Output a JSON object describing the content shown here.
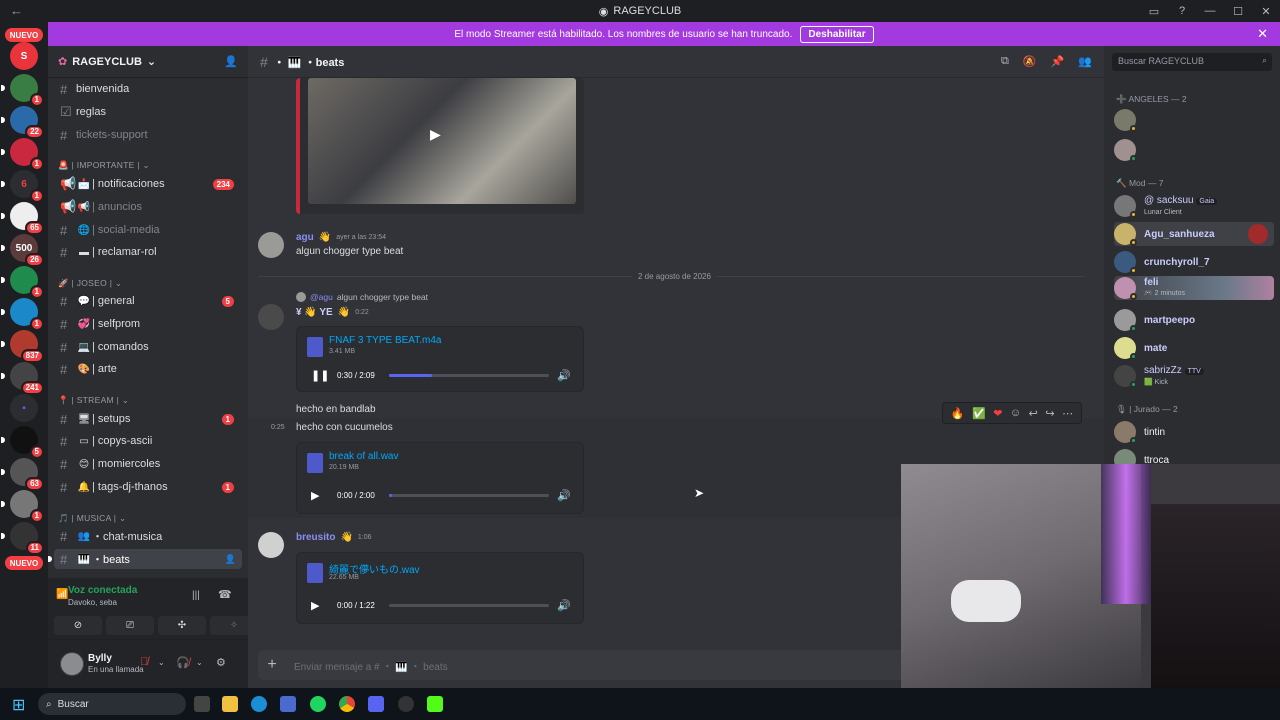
{
  "window": {
    "title": "RAGEYCLUB"
  },
  "banner": {
    "text": "El modo Streamer está habilitado. Los nombres de usuario se han truncado.",
    "button": "Deshabilitar"
  },
  "guilds": {
    "nuevo_top": "NUEVO",
    "nuevo_bottom": "NUEVO",
    "badges": [
      "1",
      "22",
      "1",
      "1",
      "65",
      "26",
      "1",
      "1",
      "837",
      "241",
      "5",
      "63",
      "1",
      "11"
    ]
  },
  "server": {
    "name": "RAGEYCLUB"
  },
  "categories": {
    "importante": "| IMPORTANTE |",
    "joseo": "| JOSEO |",
    "stream": "| STREAM |",
    "musica": "| MUSICA |"
  },
  "channels": [
    {
      "label": "bienvenida"
    },
    {
      "label": "reglas"
    },
    {
      "label": "tickets-support"
    },
    {
      "label": "| notificaciones",
      "badge": "234"
    },
    {
      "label": "| anuncios"
    },
    {
      "label": "| social-media"
    },
    {
      "label": "| reclamar-rol"
    },
    {
      "label": "| general",
      "badge": "5"
    },
    {
      "label": "| selfprom"
    },
    {
      "label": "| comandos"
    },
    {
      "label": "| arte"
    },
    {
      "label": "| setups",
      "badge": "1"
    },
    {
      "label": "| copys-ascii"
    },
    {
      "label": "| momiercoles"
    },
    {
      "label": "| tags-dj-thanos",
      "badge": "1"
    },
    {
      "label": "・chat-musica"
    },
    {
      "label": "・beats"
    }
  ],
  "voice": {
    "status": "Voz conectada",
    "sub": "Davoko, seba"
  },
  "user": {
    "name": "Bylly",
    "status": "En una llamada"
  },
  "header": {
    "channel": "・ 🎹 ・beats"
  },
  "messages": {
    "m1": {
      "author": "agu",
      "time": "ayer a las 23:54",
      "text": "algun chogger type beat"
    },
    "date_divider": "2 de agosto de 2026",
    "m2": {
      "reply_author": "@agu",
      "reply_text": "algun chogger type beat",
      "author": "¥ 👋 YE",
      "time": "0:22"
    },
    "a1": {
      "file": "FNAF 3 TYPE BEAT.m4a",
      "size": "3.41 MB",
      "time": "0:30 / 2:09",
      "progress": 0.27
    },
    "m2b": {
      "text": "hecho en bandlab"
    },
    "m2c": {
      "time": "0:25",
      "text": "hecho con cucumelos"
    },
    "a2": {
      "file": "break of all.wav",
      "size": "20.19 MB",
      "time": "0:00 / 2:00",
      "progress": 0.02
    },
    "m3": {
      "author": "breusito",
      "time": "1:06"
    },
    "a3": {
      "file": "綺麗で儚いもの.wav",
      "size": "22.65 MB",
      "time": "0:00 / 1:22",
      "progress": 0.0
    }
  },
  "composer": {
    "placeholder": "Enviar mensaje a # ・ 🎹 ・ beats"
  },
  "search": {
    "placeholder": "Buscar RAGEYCLUB"
  },
  "members": {
    "angeles": "ANGELES — 2",
    "mod": "Mod — 7",
    "jurado": "| Jurado — 2",
    "list": [
      {
        "name": "@ sacksuu",
        "tag": "Gaia",
        "sub": "Lunar Client",
        "color": "#c9cdfb"
      },
      {
        "name": "Agu_sanhueza",
        "color": "#c9cdfb"
      },
      {
        "name": "crunchyroll_7",
        "color": "#c9cdfb"
      },
      {
        "name": "feli",
        "sub": "2 minutos",
        "color": "#c9cdfb"
      },
      {
        "name": "martpeepo",
        "color": "#c9cdfb"
      },
      {
        "name": "mate",
        "color": "#c9cdfb"
      },
      {
        "name": "sabrizZz",
        "tag": "TTV",
        "sub": "Kick",
        "color": "#c9cdfb"
      },
      {
        "name": "tintin",
        "color": "#dbdee1"
      },
      {
        "name": "ttroca",
        "color": "#dbdee1"
      }
    ]
  },
  "taskbar": {
    "search": "Buscar"
  },
  "colors": {
    "accent": "#5865f2",
    "banner": "#a23adf",
    "danger": "#f23f43",
    "online": "#23a55a"
  }
}
